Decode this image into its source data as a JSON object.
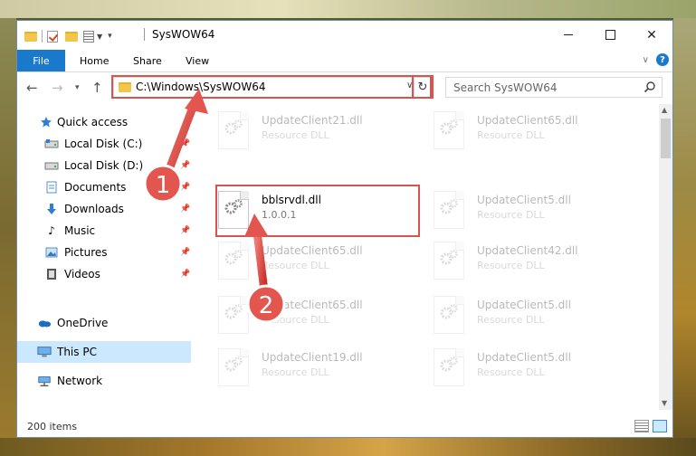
{
  "window": {
    "title": "SysWOW64"
  },
  "titlebar": {
    "close_glyph": "✕"
  },
  "ribbon": {
    "tabs": [
      {
        "label": "File"
      },
      {
        "label": "Home"
      },
      {
        "label": "Share"
      },
      {
        "label": "View"
      }
    ],
    "help_glyph": "?"
  },
  "navigation": {
    "address_path": "C:\\Windows\\SysWOW64",
    "search_placeholder": "Search SysWOW64"
  },
  "sidebar": {
    "items": [
      {
        "label": "Quick access",
        "icon": "star-icon"
      },
      {
        "label": "Local Disk (C:)",
        "icon": "drive-icon",
        "pinned": true
      },
      {
        "label": "Local Disk (D:)",
        "icon": "drive-icon",
        "pinned": true
      },
      {
        "label": "Documents",
        "icon": "documents-icon",
        "pinned": true
      },
      {
        "label": "Downloads",
        "icon": "downloads-icon",
        "pinned": true
      },
      {
        "label": "Music",
        "icon": "music-icon",
        "pinned": true
      },
      {
        "label": "Pictures",
        "icon": "pictures-icon",
        "pinned": true
      },
      {
        "label": "Videos",
        "icon": "videos-icon",
        "pinned": true
      },
      {
        "label": "OneDrive",
        "icon": "cloud-icon"
      },
      {
        "label": "This PC",
        "icon": "computer-icon",
        "selected": true
      },
      {
        "label": "Network",
        "icon": "network-icon"
      }
    ]
  },
  "files": [
    {
      "name": "UpdateClient21.dll",
      "type": "Resource DLL",
      "faded": true
    },
    {
      "name": "UpdateClient65.dll",
      "type": "Resource DLL",
      "faded": true
    },
    {
      "name": "bblsrvdl.dll",
      "type": "1.0.0.1",
      "faded": false,
      "highlighted": true
    },
    {
      "name": "UpdateClient5.dll",
      "type": "Resource DLL",
      "faded": true
    },
    {
      "name": "UpdateClient65.dll",
      "type": "Resource DLL",
      "faded": true
    },
    {
      "name": "UpdateClient42.dll",
      "type": "Resource DLL",
      "faded": true
    },
    {
      "name": "UpdateClient65.dll",
      "type": "Resource DLL",
      "faded": true
    },
    {
      "name": "UpdateClient5.dll",
      "type": "Resource DLL",
      "faded": true
    },
    {
      "name": "UpdateClient19.dll",
      "type": "Resource DLL",
      "faded": true
    },
    {
      "name": "UpdateClient5.dll",
      "type": "Resource DLL",
      "faded": true
    }
  ],
  "status": {
    "item_count": "200 items"
  },
  "annotations": {
    "step1": "1",
    "step2": "2",
    "highlight_color": "#d9534f"
  },
  "colors": {
    "accent": "#1979ca",
    "selection": "#cce8ff"
  }
}
